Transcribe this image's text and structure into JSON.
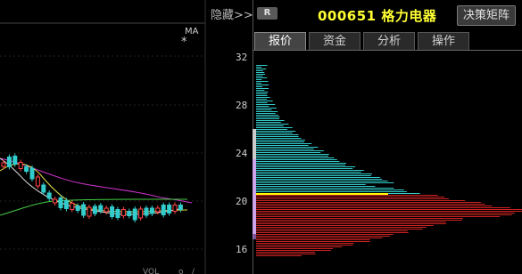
{
  "header": {
    "hide_label": "隐藏>>",
    "badge": "R",
    "stock_code": "000651",
    "stock_name": "格力电器",
    "tool_button": "决策矩阵"
  },
  "tabs": [
    {
      "label": "报价",
      "active": true
    },
    {
      "label": "资金",
      "active": false
    },
    {
      "label": "分析",
      "active": false
    },
    {
      "label": "操作",
      "active": false
    }
  ],
  "kline": {
    "ma_label": "MA",
    "ma_marker": "*"
  },
  "chip_chart": {
    "y_ticks": [
      "32",
      "28",
      "24",
      "20",
      "16"
    ],
    "current_price": 20.5,
    "avg_cost": 20.3
  },
  "colors": {
    "background": "#000000",
    "profit_bars": "#33cccc",
    "loss_bars": "#cc2222",
    "current_price_line": "#ffff00",
    "ma_yellow": "#dddd44",
    "ma_magenta": "#cc33cc",
    "ma_green": "#44cc44"
  }
}
